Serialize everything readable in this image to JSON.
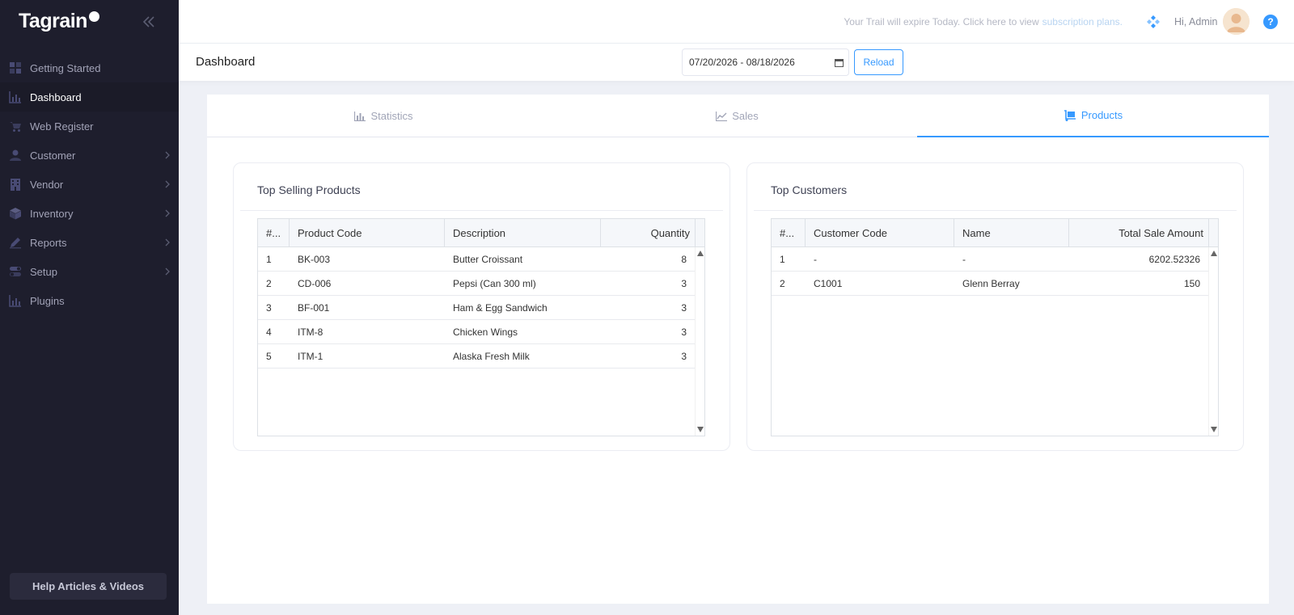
{
  "app": {
    "logo_text": "Tagrain"
  },
  "sidebar": {
    "items": [
      {
        "label": "Getting Started",
        "icon": "grid-icon",
        "has_arrow": false,
        "active": false
      },
      {
        "label": "Dashboard",
        "icon": "bar-chart-icon",
        "has_arrow": false,
        "active": true
      },
      {
        "label": "Web Register",
        "icon": "cart-icon",
        "has_arrow": false,
        "active": false
      },
      {
        "label": "Customer",
        "icon": "user-icon",
        "has_arrow": true,
        "active": false
      },
      {
        "label": "Vendor",
        "icon": "building-icon",
        "has_arrow": true,
        "active": false
      },
      {
        "label": "Inventory",
        "icon": "box-icon",
        "has_arrow": true,
        "active": false
      },
      {
        "label": "Reports",
        "icon": "pen-icon",
        "has_arrow": true,
        "active": false
      },
      {
        "label": "Setup",
        "icon": "toggle-icon",
        "has_arrow": true,
        "active": false
      },
      {
        "label": "Plugins",
        "icon": "bar-chart-icon",
        "has_arrow": false,
        "active": false
      }
    ],
    "help_label": "Help Articles & Videos"
  },
  "header": {
    "trial_text": "Your Trail will expire Today. Click here to view",
    "trial_link": "subscription plans.",
    "greeting": "Hi, Admin",
    "help_glyph": "?"
  },
  "subheader": {
    "title": "Dashboard",
    "date_range": "07/20/2026 - 08/18/2026",
    "reload_label": "Reload"
  },
  "tabs": [
    {
      "label": "Statistics",
      "icon": "bar-chart-icon",
      "active": false
    },
    {
      "label": "Sales",
      "icon": "line-chart-icon",
      "active": false
    },
    {
      "label": "Products",
      "icon": "dolly-icon",
      "active": true
    }
  ],
  "top_products": {
    "title": "Top Selling Products",
    "columns": [
      "#...",
      "Product Code",
      "Description",
      "Quantity"
    ],
    "rows": [
      {
        "n": "1",
        "code": "BK-003",
        "description": "Butter Croissant",
        "qty": "8"
      },
      {
        "n": "2",
        "code": "CD-006",
        "description": "Pepsi (Can 300 ml)",
        "qty": "3"
      },
      {
        "n": "3",
        "code": "BF-001",
        "description": "Ham & Egg Sandwich",
        "qty": "3"
      },
      {
        "n": "4",
        "code": "ITM-8",
        "description": "Chicken Wings",
        "qty": "3"
      },
      {
        "n": "5",
        "code": "ITM-1",
        "description": "Alaska Fresh Milk",
        "qty": "3"
      }
    ]
  },
  "top_customers": {
    "title": "Top Customers",
    "columns": [
      "#...",
      "Customer Code",
      "Name",
      "Total Sale Amount"
    ],
    "rows": [
      {
        "n": "1",
        "code": "-",
        "name": "-",
        "amount": "6202.52326"
      },
      {
        "n": "2",
        "code": "C1001",
        "name": "Glenn Berray",
        "amount": "150"
      }
    ]
  },
  "colors": {
    "accent": "#3699ff",
    "sidebar_bg": "#1e1e2d",
    "page_bg": "#eef0f6"
  }
}
